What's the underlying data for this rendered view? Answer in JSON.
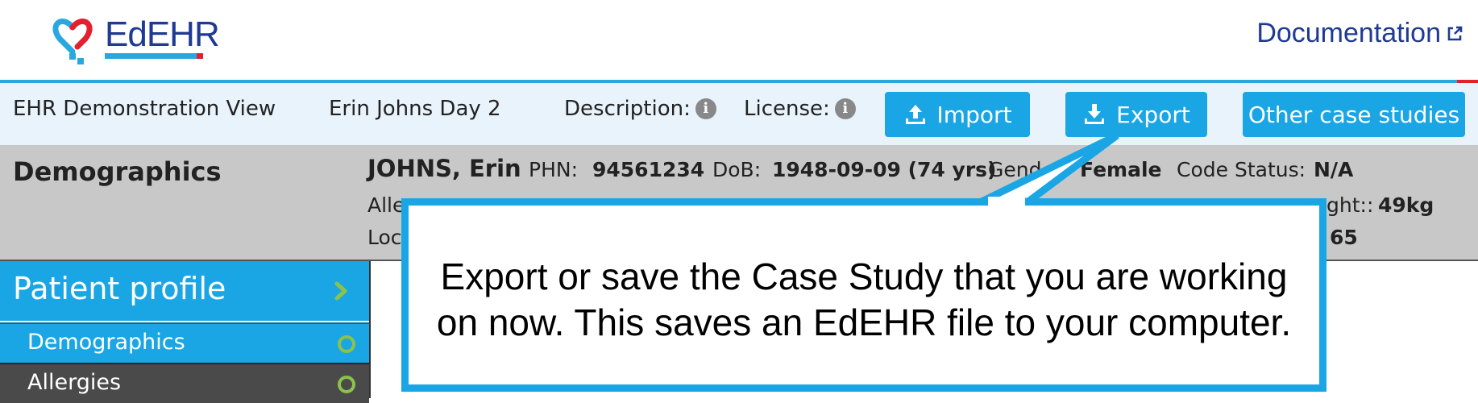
{
  "header": {
    "logo_text": "EdEHR",
    "documentation_label": "Documentation"
  },
  "toolbar": {
    "view_label": "EHR Demonstration View",
    "case_name": "Erin Johns Day 2",
    "description_label": "Description:",
    "license_label": "License:",
    "import_label": "Import",
    "export_label": "Export",
    "other_cases_label": "Other case studies"
  },
  "banner": {
    "section_title": "Demographics",
    "patient_name": "JOHNS, Erin",
    "phn_label": "PHN:",
    "phn_value": "94561234",
    "dob_label": "DoB:",
    "dob_value": "1948-09-09 (74 yrs)",
    "gender_label": "Gend",
    "gender_value": "Female",
    "code_status_label": "Code Status:",
    "code_status_value": "N/A",
    "allergies_label_partial": "Alle",
    "weight_label_partial": "ght::",
    "weight_value": "49kg",
    "location_label_partial": "Loc",
    "partial_value": "65"
  },
  "sidebar": {
    "header": "Patient profile",
    "items": [
      {
        "label": "Demographics"
      },
      {
        "label": "Allergies"
      }
    ]
  },
  "callout": {
    "line1": "Export or save the Case Study that you are working",
    "line2": "on now. This saves an EdEHR file to your computer."
  },
  "colors": {
    "brand_blue": "#1aa6e4",
    "brand_navy": "#1f3a93",
    "brand_red": "#e2202f",
    "status_ring": "#8bc34a"
  },
  "icons": [
    "heart-logo-icon",
    "external-link-icon",
    "info-icon",
    "upload-icon",
    "download-icon",
    "chevron-right-icon",
    "status-ring-icon"
  ]
}
